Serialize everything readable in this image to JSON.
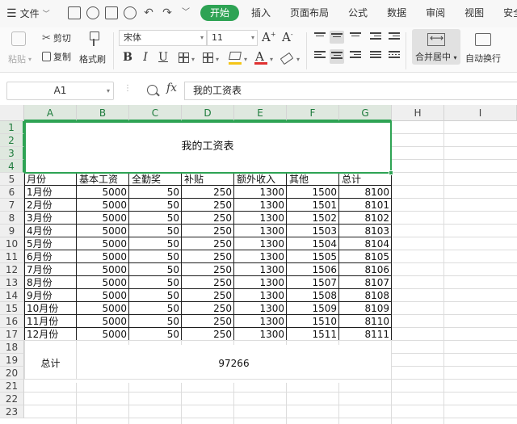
{
  "menu": {
    "file_label": "文件",
    "tabs": [
      {
        "label": "开始",
        "active": true
      },
      {
        "label": "插入",
        "active": false
      },
      {
        "label": "页面布局",
        "active": false
      },
      {
        "label": "公式",
        "active": false
      },
      {
        "label": "数据",
        "active": false
      },
      {
        "label": "审阅",
        "active": false
      },
      {
        "label": "视图",
        "active": false
      },
      {
        "label": "安全",
        "active": false
      }
    ]
  },
  "ribbon": {
    "paste": "粘贴",
    "cut": "剪切",
    "copy": "复制",
    "format_painter": "格式刷",
    "font_name": "宋体",
    "font_size": "11",
    "merge_center": "合并居中",
    "wrap_text": "自动换行"
  },
  "colors": {
    "accent": "#2ea354",
    "font_color": "#e03030",
    "fill_color": "#f5c518"
  },
  "formula_bar": {
    "name_box": "A1",
    "fx": "fx",
    "value": "我的工资表"
  },
  "sheet": {
    "columns": [
      "A",
      "B",
      "C",
      "D",
      "E",
      "F",
      "G",
      "H",
      "I"
    ],
    "rows": [
      "1",
      "2",
      "3",
      "4",
      "5",
      "6",
      "7",
      "8",
      "9",
      "10",
      "11",
      "12",
      "13",
      "14",
      "15",
      "16",
      "17",
      "18",
      "19",
      "20",
      "21",
      "22",
      "23"
    ],
    "title": "我的工资表",
    "headers": [
      "月份",
      "基本工资",
      "全勤奖",
      "补贴",
      "额外收入",
      "其他",
      "总计"
    ],
    "data": [
      [
        "1月份",
        "5000",
        "50",
        "250",
        "1300",
        "1500",
        "8100"
      ],
      [
        "2月份",
        "5000",
        "50",
        "250",
        "1300",
        "1501",
        "8101"
      ],
      [
        "3月份",
        "5000",
        "50",
        "250",
        "1300",
        "1502",
        "8102"
      ],
      [
        "4月份",
        "5000",
        "50",
        "250",
        "1300",
        "1503",
        "8103"
      ],
      [
        "5月份",
        "5000",
        "50",
        "250",
        "1300",
        "1504",
        "8104"
      ],
      [
        "6月份",
        "5000",
        "50",
        "250",
        "1300",
        "1505",
        "8105"
      ],
      [
        "7月份",
        "5000",
        "50",
        "250",
        "1300",
        "1506",
        "8106"
      ],
      [
        "8月份",
        "5000",
        "50",
        "250",
        "1300",
        "1507",
        "8107"
      ],
      [
        "9月份",
        "5000",
        "50",
        "250",
        "1300",
        "1508",
        "8108"
      ],
      [
        "10月份",
        "5000",
        "50",
        "250",
        "1300",
        "1509",
        "8109"
      ],
      [
        "11月份",
        "5000",
        "50",
        "250",
        "1300",
        "1510",
        "8110"
      ],
      [
        "12月份",
        "5000",
        "50",
        "250",
        "1300",
        "1511",
        "8111"
      ]
    ],
    "total_label": "总计",
    "total_value": "97266"
  }
}
